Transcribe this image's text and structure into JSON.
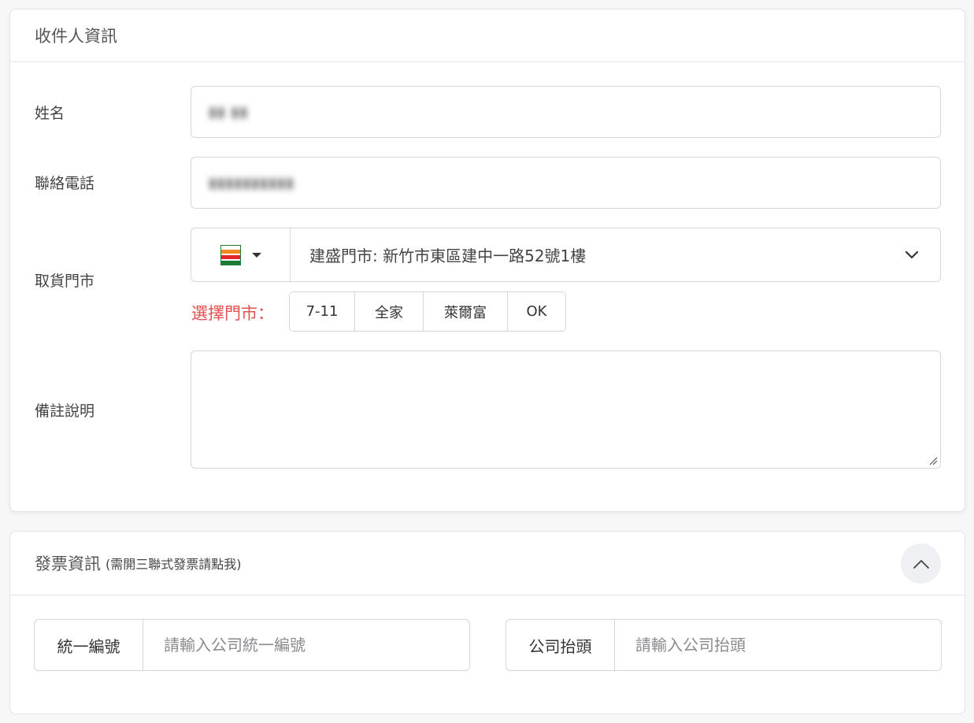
{
  "recipient": {
    "title": "收件人資訊",
    "name_label": "姓名",
    "name_value": "▮▮ ▮▮",
    "phone_label": "聯絡電話",
    "phone_value": "▮▮▮▮▮▮▮▮▮▮",
    "store_label": "取貨門市",
    "store_brand_icon": "seven-eleven-logo",
    "store_value": "建盛門市: 新竹市東區建中一路52號1樓",
    "choose_store_label": "選擇門市：",
    "store_buttons": [
      "7-11",
      "全家",
      "萊爾富",
      "OK"
    ],
    "note_label": "備註說明",
    "note_value": ""
  },
  "invoice": {
    "title": "發票資訊",
    "title_note": "(需開三聯式發票請點我)",
    "tax_id_label": "統一編號",
    "tax_id_placeholder": "請輸入公司統一編號",
    "company_label": "公司抬頭",
    "company_placeholder": "請輸入公司抬頭"
  },
  "colors": {
    "accent_red": "#e0524f",
    "border": "#d6d6da",
    "collapse_bg": "#eef0f4"
  }
}
